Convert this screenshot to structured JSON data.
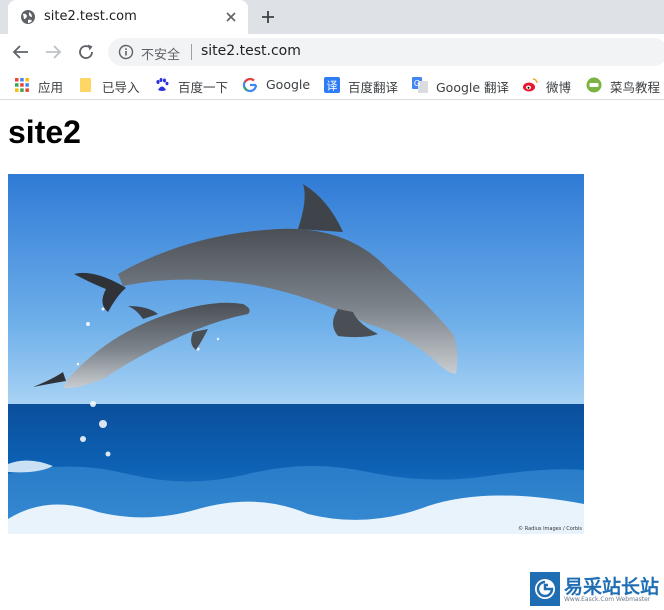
{
  "tab": {
    "title": "site2.test.com"
  },
  "toolbar": {
    "security_label": "不安全",
    "url": "site2.test.com"
  },
  "bookmarks": [
    {
      "label": "应用",
      "icon": "apps-grid-icon"
    },
    {
      "label": "已导入",
      "icon": "folder-icon"
    },
    {
      "label": "百度一下",
      "icon": "baidu-paw-icon"
    },
    {
      "label": "Google",
      "icon": "google-g-icon"
    },
    {
      "label": "百度翻译",
      "icon": "baidu-translate-icon"
    },
    {
      "label": "Google 翻译",
      "icon": "google-translate-icon"
    },
    {
      "label": "微博",
      "icon": "weibo-icon"
    },
    {
      "label": "菜鸟教程",
      "icon": "runoob-icon"
    }
  ],
  "page": {
    "heading": "site2",
    "image_credit": "© Radius Images / Corbis"
  },
  "watermark": {
    "text": "易采站长站",
    "subtext": "Www.Easck.Com Webmaster"
  },
  "colors": {
    "tabstrip_bg": "#dee1e6",
    "omnibox_bg": "#f1f3f4",
    "watermark_blue": "#1f6db3"
  }
}
